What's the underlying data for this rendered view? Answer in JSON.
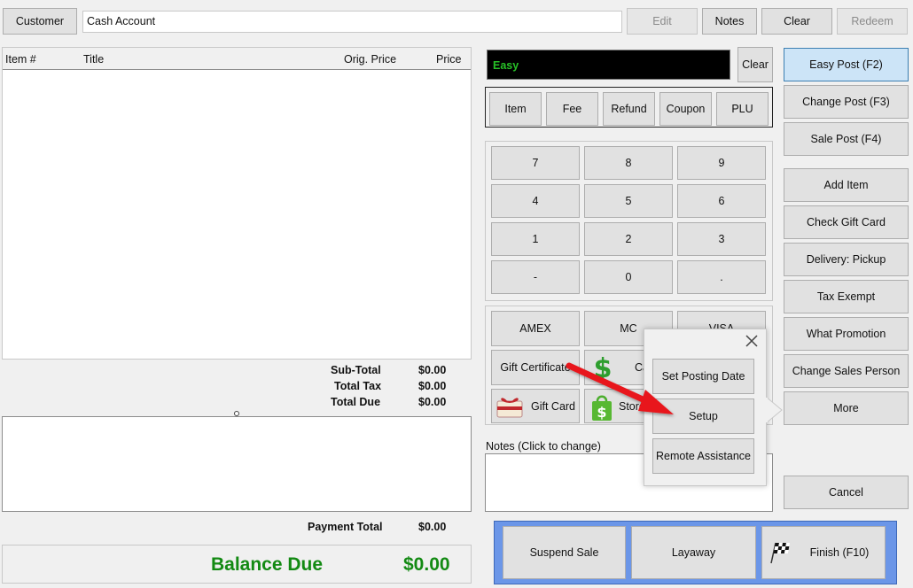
{
  "topbar": {
    "customer_label": "Customer",
    "customer_value": "Cash Account",
    "edit_label": "Edit",
    "notes_label": "Notes",
    "clear_label": "Clear",
    "redeem_label": "Redeem"
  },
  "items_table": {
    "columns": [
      "Item #",
      "Title",
      "Orig. Price",
      "Price"
    ]
  },
  "totals": {
    "subtotal_label": "Sub-Total",
    "subtotal_value": "$0.00",
    "tax_label": "Total Tax",
    "tax_value": "$0.00",
    "due_label": "Total Due",
    "due_value": "$0.00",
    "payment_label": "Payment Total",
    "payment_value": "$0.00",
    "balance_label": "Balance Due",
    "balance_value": "$0.00"
  },
  "entry": {
    "display_text": "Easy",
    "clear_label": "Clear"
  },
  "modes": [
    "Item",
    "Fee",
    "Refund",
    "Coupon",
    "PLU"
  ],
  "keypad": [
    "7",
    "8",
    "9",
    "4",
    "5",
    "6",
    "1",
    "2",
    "3",
    "-",
    "0",
    "."
  ],
  "tenders": {
    "amex": "AMEX",
    "mc": "MC",
    "visa": "VISA",
    "gift_certificate": "Gift Certificate",
    "cash": "Cash",
    "gift_card": "Gift Card",
    "store_credit": "Store"
  },
  "notes": {
    "label": "Notes (Click to change)"
  },
  "sidebar": {
    "easy_post": "Easy Post (F2)",
    "change_post": "Change Post (F3)",
    "sale_post": "Sale Post (F4)",
    "add_item": "Add Item",
    "check_gift_card": "Check Gift Card",
    "delivery": "Delivery: Pickup",
    "tax_exempt": "Tax Exempt",
    "what_promotion": "What Promotion",
    "change_sales_person": "Change Sales Person",
    "more": "More",
    "cancel": "Cancel"
  },
  "bottom_actions": {
    "suspend": "Suspend Sale",
    "layaway": "Layaway",
    "finish": "Finish (F10)"
  },
  "popup": {
    "set_posting_date": "Set Posting Date",
    "setup": "Setup",
    "remote_assistance": "Remote Assistance"
  },
  "colors": {
    "accent_blue": "#6b96e8",
    "balance_green": "#138a13",
    "display_text_green": "#27c127",
    "arrow_red": "#e8141a"
  }
}
